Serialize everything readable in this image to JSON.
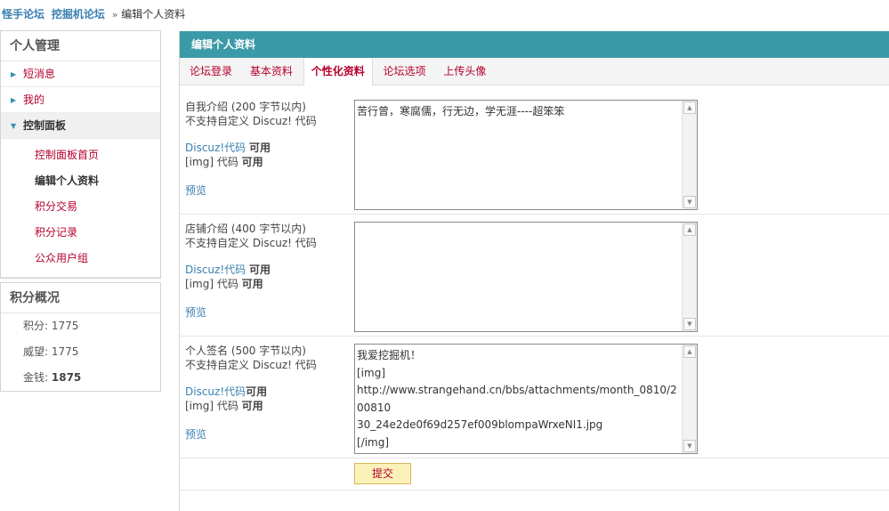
{
  "breadcrumb": {
    "links": [
      "怪手论坛",
      "挖掘机论坛"
    ],
    "separator": "»",
    "current": "编辑个人资料"
  },
  "sidebar": {
    "title": "个人管理",
    "items": [
      {
        "label": "短消息",
        "icon": "triangle-right-icon"
      },
      {
        "label": "我的",
        "icon": "triangle-right-icon"
      },
      {
        "label": "控制面板",
        "icon": "triangle-down-icon"
      }
    ],
    "subitems": [
      "控制面板首页",
      "编辑个人资料",
      "积分交易",
      "积分记录",
      "公众用户组"
    ]
  },
  "score": {
    "title": "积分概况",
    "rows": [
      {
        "label": "积分:",
        "value": "1775"
      },
      {
        "label": "威望:",
        "value": "1775"
      },
      {
        "label": "金钱:",
        "value": "1875"
      }
    ]
  },
  "main": {
    "title": "编辑个人资料",
    "tabs": [
      "论坛登录",
      "基本资料",
      "个性化资料",
      "论坛选项",
      "上传头像"
    ],
    "active_tab": "个性化资料",
    "fields": [
      {
        "label": "自我介绍 (200 字节以内)",
        "note": "不支持自定义 Discuz! 代码",
        "code1": "Discuz!代码",
        "code1_status": "可用",
        "code2": "[img] 代码",
        "code2_status": "可用",
        "preview": "预览",
        "value_lines": [
          "苦行曾，寒腐儒，行无边，学无涯----超笨笨"
        ]
      },
      {
        "label": "店铺介绍 (400 字节以内)",
        "note": "不支持自定义 Discuz! 代码",
        "code1": "Discuz!代码",
        "code1_status": "可用",
        "code2": "[img] 代码",
        "code2_status": "可用",
        "preview": "预览",
        "value_lines": []
      },
      {
        "label": "个人签名 (500 字节以内)",
        "note": "不支持自定义 Discuz! 代码",
        "code1": "Discuz!代码",
        "code1_status": "可用",
        "code2": "[img] 代码",
        "code2_status": "可用",
        "preview": "预览",
        "value_lines": [
          "我爱挖掘机！",
          "[img]",
          "http://www.strangehand.cn/bbs/attachments/month_0810/200810",
          "30_24e2de0f69d257ef009blompaWrxeNI1.jpg",
          "[/img]"
        ]
      }
    ],
    "submit_label": "提交"
  },
  "colors": {
    "title_bar": "#3b9aa7",
    "link_red": "#b5002e",
    "link_blue": "#3a7fb0",
    "submit_bg": "#fbf1b9"
  }
}
